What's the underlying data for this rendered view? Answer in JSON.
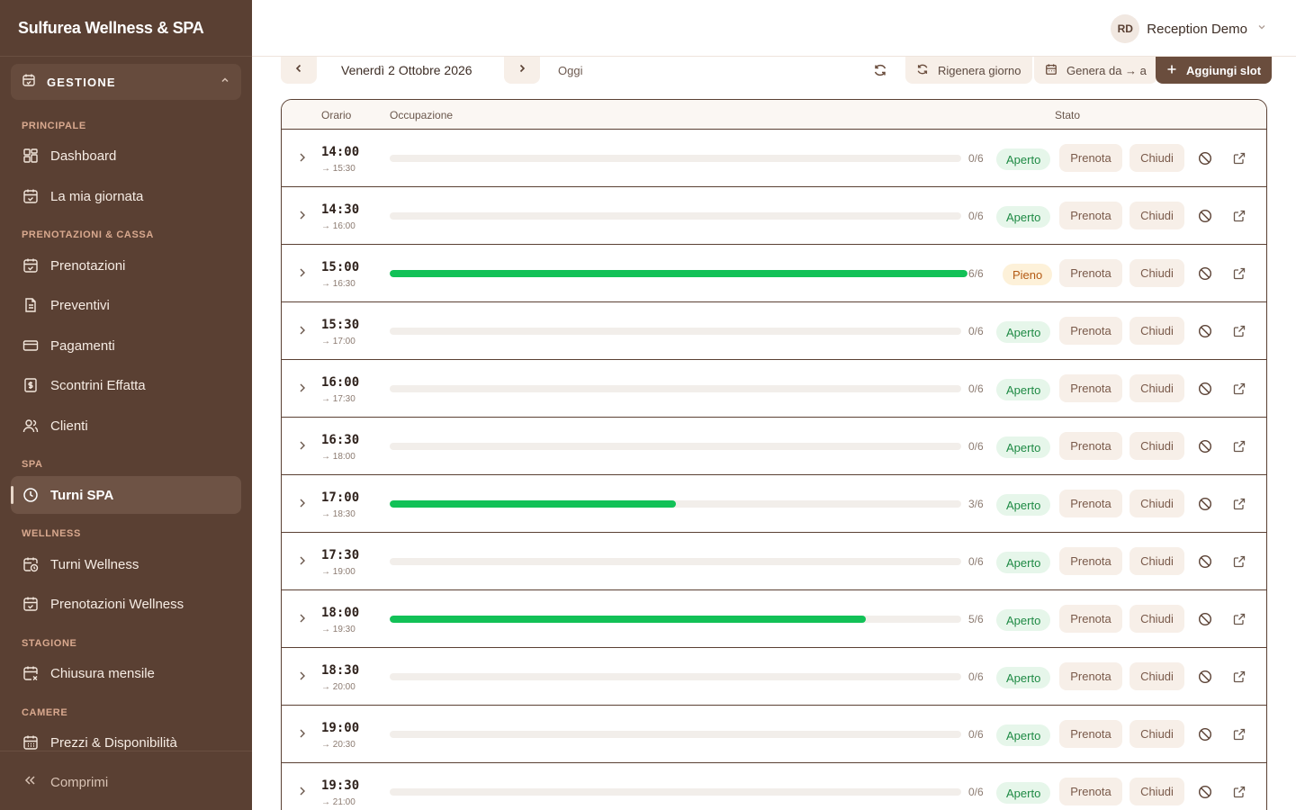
{
  "app": {
    "brand": "Sulfurea Wellness & SPA"
  },
  "sidebar": {
    "section_label": "GESTIONE",
    "groups": {
      "principale": "PRINCIPALE",
      "prenotazioni": "PRENOTAZIONI & CASSA",
      "spa": "SPA",
      "wellness": "WELLNESS",
      "stagione": "STAGIONE",
      "camere": "CAMERE"
    },
    "items": {
      "dashboard": "Dashboard",
      "giornata": "La mia giornata",
      "prenotazioni": "Prenotazioni",
      "preventivi": "Preventivi",
      "pagamenti": "Pagamenti",
      "scontrini": "Scontrini Effatta",
      "clienti": "Clienti",
      "turni_spa": "Turni SPA",
      "turni_wellness": "Turni Wellness",
      "pren_wellness": "Prenotazioni Wellness",
      "chiusura": "Chiusura mensile",
      "prezzi": "Prezzi & Disponibilità"
    },
    "active": "turni_spa",
    "collapse_label": "Comprimi"
  },
  "user": {
    "initials": "RD",
    "name": "Reception Demo"
  },
  "toolbar": {
    "date": "Venerdì 2 Ottobre 2026",
    "today": "Oggi",
    "regenerate": "Rigenera giorno",
    "generate": "Genera da → a",
    "add": "Aggiungi slot"
  },
  "table": {
    "headers": {
      "time": "Orario",
      "occupancy": "Occupazione",
      "status": "Stato"
    },
    "book_label": "Prenota",
    "close_label": "Chiudi",
    "capacity": 6,
    "rows": [
      {
        "start": "14:00",
        "end": "→ 15:30",
        "booked": 0,
        "count": "0/6",
        "status": "Aperto",
        "state": "open"
      },
      {
        "start": "14:30",
        "end": "→ 16:00",
        "booked": 0,
        "count": "0/6",
        "status": "Aperto",
        "state": "open"
      },
      {
        "start": "15:00",
        "end": "→ 16:30",
        "booked": 6,
        "count": "6/6",
        "status": "Pieno",
        "state": "full"
      },
      {
        "start": "15:30",
        "end": "→ 17:00",
        "booked": 0,
        "count": "0/6",
        "status": "Aperto",
        "state": "open"
      },
      {
        "start": "16:00",
        "end": "→ 17:30",
        "booked": 0,
        "count": "0/6",
        "status": "Aperto",
        "state": "open"
      },
      {
        "start": "16:30",
        "end": "→ 18:00",
        "booked": 0,
        "count": "0/6",
        "status": "Aperto",
        "state": "open"
      },
      {
        "start": "17:00",
        "end": "→ 18:30",
        "booked": 3,
        "count": "3/6",
        "status": "Aperto",
        "state": "open"
      },
      {
        "start": "17:30",
        "end": "→ 19:00",
        "booked": 0,
        "count": "0/6",
        "status": "Aperto",
        "state": "open"
      },
      {
        "start": "18:00",
        "end": "→ 19:30",
        "booked": 5,
        "count": "5/6",
        "status": "Aperto",
        "state": "open"
      },
      {
        "start": "18:30",
        "end": "→ 20:00",
        "booked": 0,
        "count": "0/6",
        "status": "Aperto",
        "state": "open"
      },
      {
        "start": "19:00",
        "end": "→ 20:30",
        "booked": 0,
        "count": "0/6",
        "status": "Aperto",
        "state": "open"
      },
      {
        "start": "19:30",
        "end": "→ 21:00",
        "booked": 0,
        "count": "0/6",
        "status": "Aperto",
        "state": "open"
      }
    ]
  },
  "colors": {
    "sidebar": "#5a4033",
    "accent": "#6a4d3d",
    "progress": "#12c157",
    "open": "#1e8a44",
    "full": "#b35a14"
  }
}
